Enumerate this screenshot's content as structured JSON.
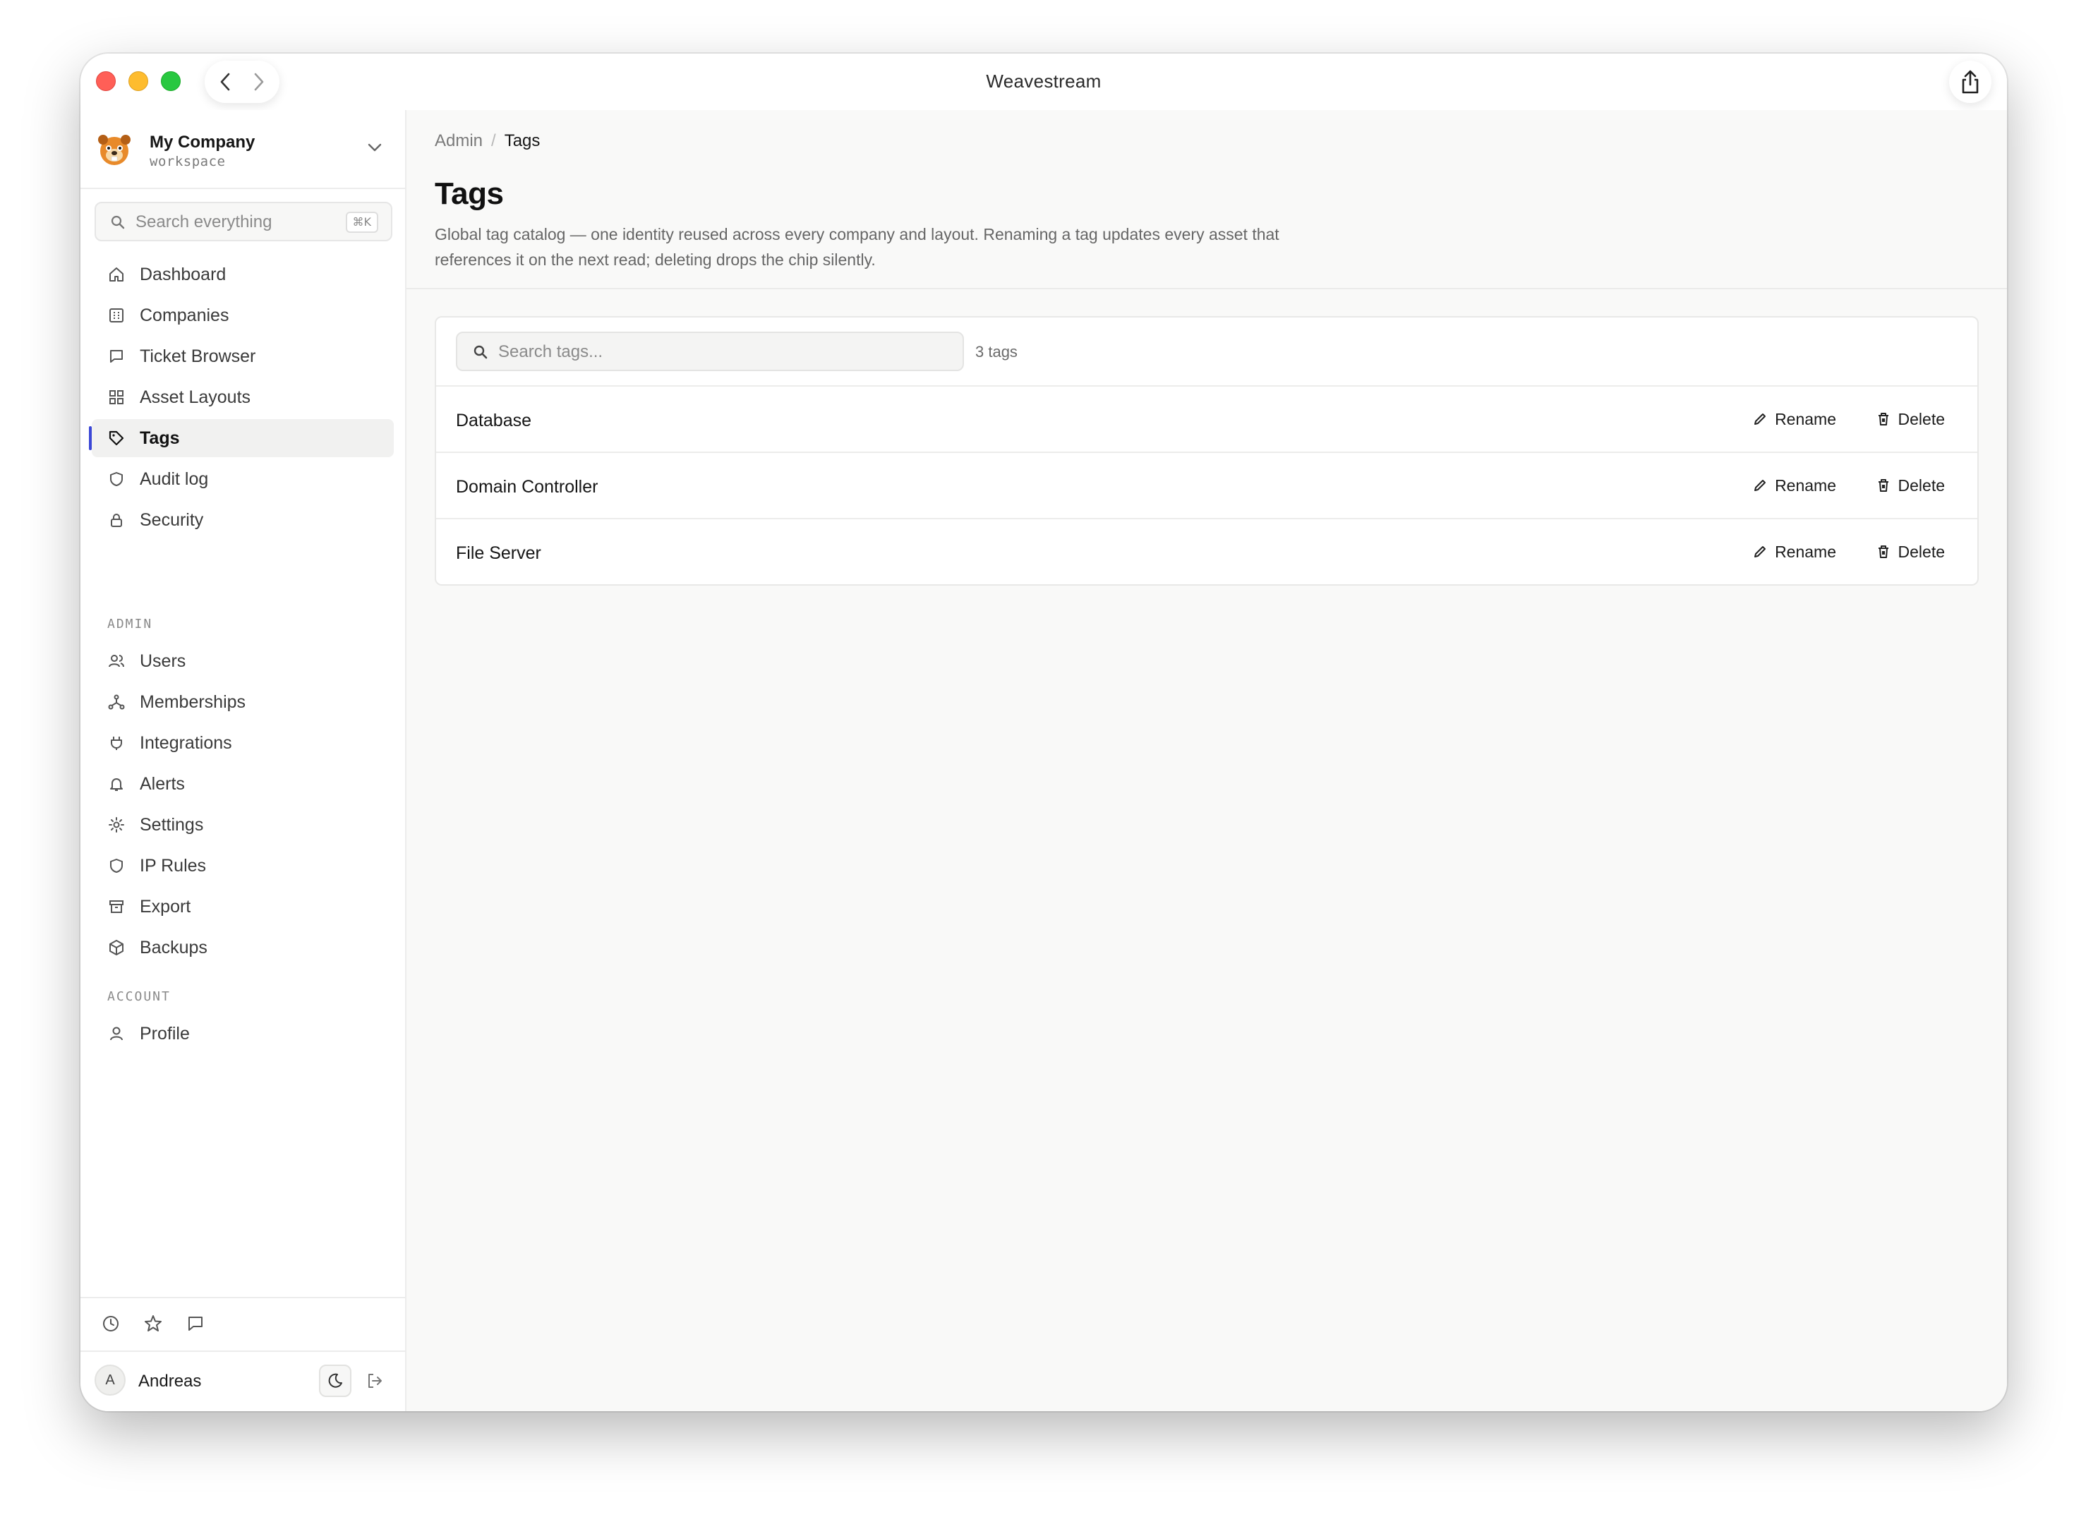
{
  "window": {
    "title": "Weavestream"
  },
  "workspace": {
    "name": "My Company",
    "subtitle": "workspace"
  },
  "search": {
    "placeholder": "Search everything",
    "shortcut": "⌘K"
  },
  "nav": {
    "main": [
      {
        "label": "Dashboard",
        "icon": "home-icon"
      },
      {
        "label": "Companies",
        "icon": "building-icon"
      },
      {
        "label": "Ticket Browser",
        "icon": "message-square-icon"
      },
      {
        "label": "Asset Layouts",
        "icon": "grid-icon"
      },
      {
        "label": "Tags",
        "icon": "tag-icon",
        "active": true
      },
      {
        "label": "Audit log",
        "icon": "shield-icon"
      },
      {
        "label": "Security",
        "icon": "lock-icon"
      }
    ],
    "admin_label": "ADMIN",
    "admin": [
      {
        "label": "Users",
        "icon": "users-icon"
      },
      {
        "label": "Memberships",
        "icon": "network-icon"
      },
      {
        "label": "Integrations",
        "icon": "plug-icon"
      },
      {
        "label": "Alerts",
        "icon": "bell-icon"
      },
      {
        "label": "Settings",
        "icon": "sun-gear-icon"
      },
      {
        "label": "IP Rules",
        "icon": "shield-icon"
      },
      {
        "label": "Export",
        "icon": "archive-icon"
      },
      {
        "label": "Backups",
        "icon": "box-icon"
      }
    ],
    "account_label": "ACCOUNT",
    "account": [
      {
        "label": "Profile",
        "icon": "user-icon"
      }
    ]
  },
  "user": {
    "name": "Andreas",
    "initial": "A"
  },
  "breadcrumb": {
    "parent": "Admin",
    "separator": "/",
    "current": "Tags"
  },
  "page": {
    "title": "Tags",
    "description": "Global tag catalog — one identity reused across every company and layout. Renaming a tag updates every asset that references it on the next read; deleting drops the chip silently."
  },
  "tags": {
    "search_placeholder": "Search tags...",
    "count_label": "3 tags",
    "rename_label": "Rename",
    "delete_label": "Delete",
    "rows": [
      {
        "name": "Database"
      },
      {
        "name": "Domain Controller"
      },
      {
        "name": "File Server"
      }
    ]
  },
  "colors": {
    "accent": "#3b47d6",
    "traffic_red": "#ff5f57",
    "traffic_yellow": "#febc2e",
    "traffic_green": "#28c840"
  }
}
